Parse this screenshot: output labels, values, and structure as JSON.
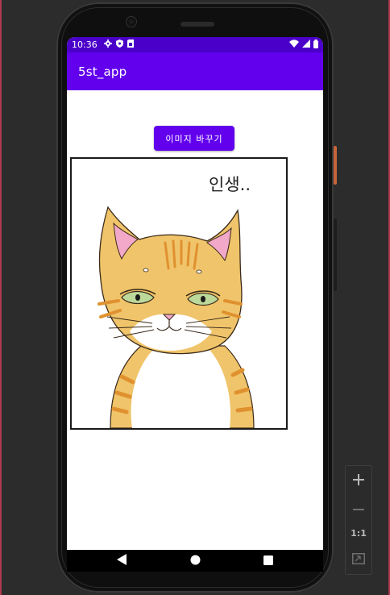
{
  "status_bar": {
    "time": "10:36",
    "left_icons": [
      "gear-icon",
      "shield-icon",
      "sim-icon"
    ],
    "right_icons": [
      "wifi-icon",
      "signal-icon",
      "battery-icon"
    ]
  },
  "app_bar": {
    "title": "5st_app"
  },
  "main": {
    "change_image_button": "이미지 바꾸기",
    "image_caption": "인생..",
    "image_subject": "cat-illustration"
  },
  "nav_bar": {
    "back": "back-icon",
    "home": "home-icon",
    "recents": "recents-icon"
  },
  "emulator_toolbar": {
    "zoom_in": "zoom-in-icon",
    "zoom_out": "zoom-out-icon",
    "actual_size_label": "1:1",
    "fit_screen": "fit-screen-icon"
  },
  "colors": {
    "status_bar": "#4a00c8",
    "app_bar": "#6200ee",
    "button": "#6200ee",
    "cat_fur": "#f0c46a",
    "cat_stripes": "#e0912f",
    "cat_ears_inner": "#f2a8c8",
    "cat_eyes": "#bcd89a"
  }
}
